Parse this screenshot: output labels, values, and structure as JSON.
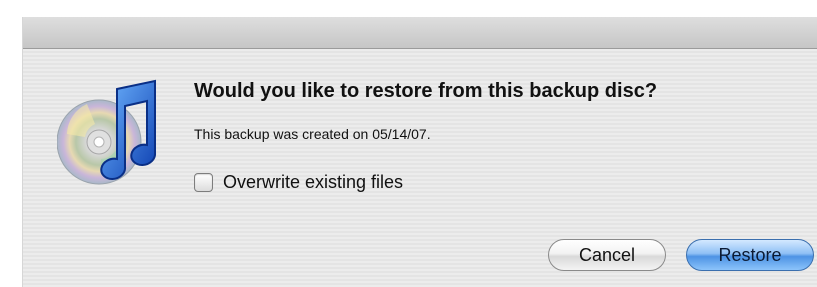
{
  "dialog": {
    "icon": "itunes-cd-icon",
    "heading": "Would you like to restore from this backup disc?",
    "message": "This backup was created on 05/14/07.",
    "checkbox": {
      "label": "Overwrite existing files",
      "checked": false
    },
    "buttons": {
      "cancel_label": "Cancel",
      "restore_label": "Restore"
    }
  },
  "colors": {
    "default_button": "#5a9ce8",
    "icon_blue": "#1f5fd0"
  }
}
